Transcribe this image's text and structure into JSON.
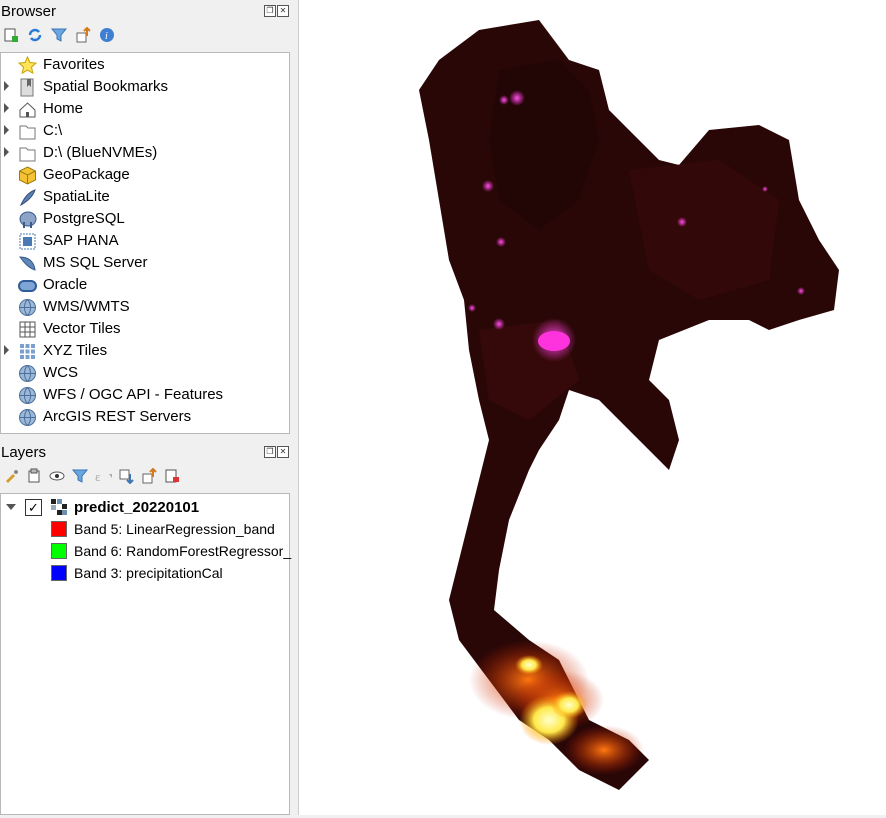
{
  "browser": {
    "title": "Browser",
    "items": [
      {
        "label": "Favorites",
        "icon": "star-icon"
      },
      {
        "label": "Spatial Bookmarks",
        "icon": "bookmark-icon"
      },
      {
        "label": "Home",
        "icon": "home-icon"
      },
      {
        "label": "C:\\",
        "icon": "folder-icon"
      },
      {
        "label": "D:\\ (BlueNVMEs)",
        "icon": "folder-icon"
      },
      {
        "label": "GeoPackage",
        "icon": "geopackage-icon"
      },
      {
        "label": "SpatiaLite",
        "icon": "feather-icon"
      },
      {
        "label": "PostgreSQL",
        "icon": "elephant-icon"
      },
      {
        "label": "SAP HANA",
        "icon": "hana-icon"
      },
      {
        "label": "MS SQL Server",
        "icon": "mssql-icon"
      },
      {
        "label": "Oracle",
        "icon": "oracle-icon"
      },
      {
        "label": "WMS/WMTS",
        "icon": "globe-icon"
      },
      {
        "label": "Vector Tiles",
        "icon": "grid-icon"
      },
      {
        "label": "XYZ Tiles",
        "icon": "tiles-icon"
      },
      {
        "label": "WCS",
        "icon": "globe-icon"
      },
      {
        "label": "WFS / OGC API - Features",
        "icon": "globe-icon"
      },
      {
        "label": "ArcGIS REST Servers",
        "icon": "globe-icon"
      }
    ]
  },
  "layers": {
    "title": "Layers",
    "layer_name": "predict_20220101",
    "bands": [
      {
        "label": "Band 5: LinearRegression_band",
        "color": "#ff0000"
      },
      {
        "label": "Band 6: RandomForestRegressor_",
        "color": "#00ff00"
      },
      {
        "label": "Band 3: precipitationCal",
        "color": "#0000ff"
      }
    ]
  },
  "colors": {
    "map_dark": "#2a0707",
    "hotspot_pink": "#ff33dd",
    "hotspot_orange": "#ff6a00",
    "hotspot_yellow": "#ffff66"
  }
}
